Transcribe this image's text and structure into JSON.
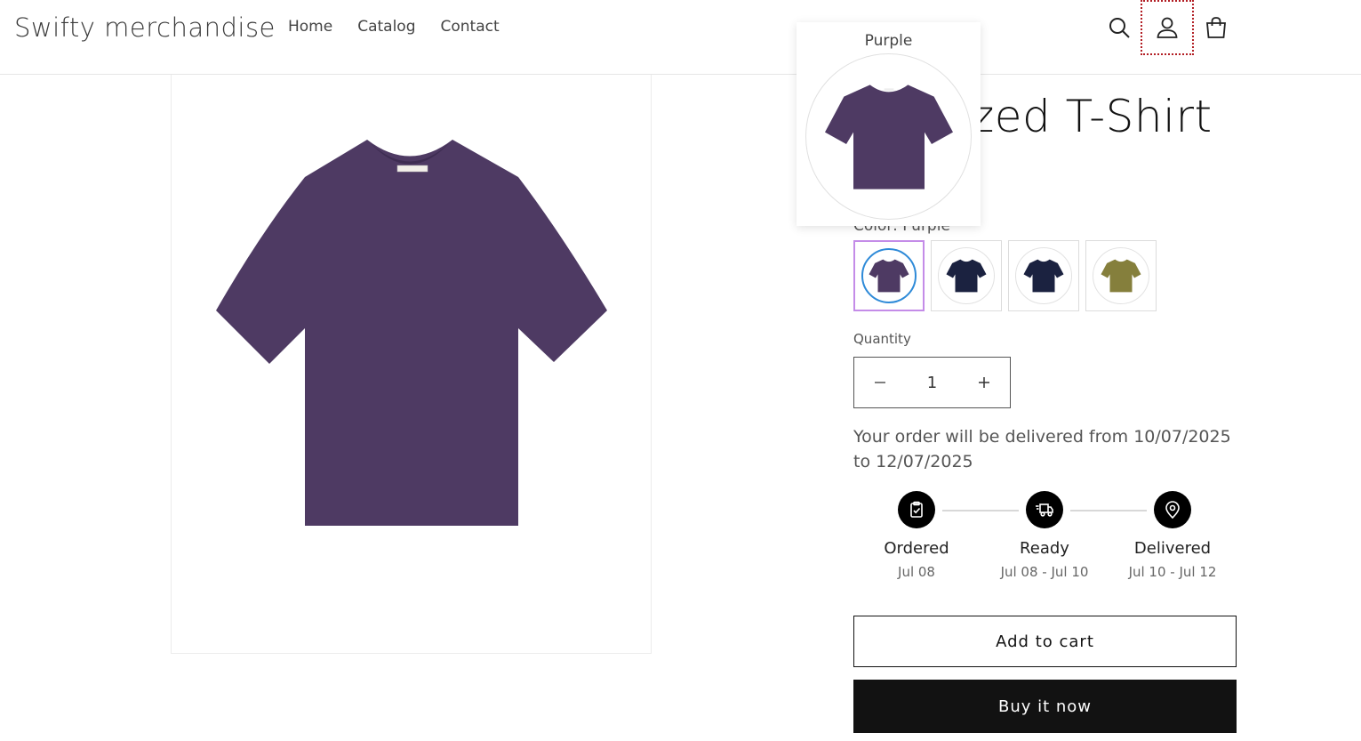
{
  "header": {
    "store_name": "Swifty merchandise",
    "nav": [
      {
        "label": "Home"
      },
      {
        "label": "Catalog"
      },
      {
        "label": "Contact"
      }
    ],
    "icons": [
      "search-icon",
      "account-icon",
      "cart-icon"
    ]
  },
  "product": {
    "title_visible": "zed T-Shirt",
    "color_label": "Color: Purple",
    "colors": [
      {
        "name": "Purple",
        "hex": "#4e3a63",
        "selected": true
      },
      {
        "name": "Navy",
        "hex": "#1b2240",
        "selected": false
      },
      {
        "name": "Navy",
        "hex": "#1b2240",
        "selected": false
      },
      {
        "name": "Olive",
        "hex": "#857f3c",
        "selected": false
      }
    ],
    "quantity_label": "Quantity",
    "quantity_value": "1",
    "delivery_text": "Your order will be delivered from 10/07/2025 to 12/07/2025",
    "timeline": [
      {
        "label": "Ordered",
        "date": "Jul 08",
        "icon": "clipboard-check-icon"
      },
      {
        "label": "Ready",
        "date": "Jul 08 - Jul 10",
        "icon": "truck-icon"
      },
      {
        "label": "Delivered",
        "date": "Jul 10 - Jul 12",
        "icon": "location-pin-icon"
      }
    ],
    "add_to_cart_label": "Add to cart",
    "buy_now_label": "Buy it now"
  },
  "tooltip": {
    "label": "Purple"
  },
  "colors": {
    "tshirt_main": "#4e3a63",
    "button_dark": "#121212",
    "swatch_selected_border": "#c48ce8",
    "swatch_selected_ring": "#2e8ad8",
    "focus_outline": "#b21e24"
  }
}
